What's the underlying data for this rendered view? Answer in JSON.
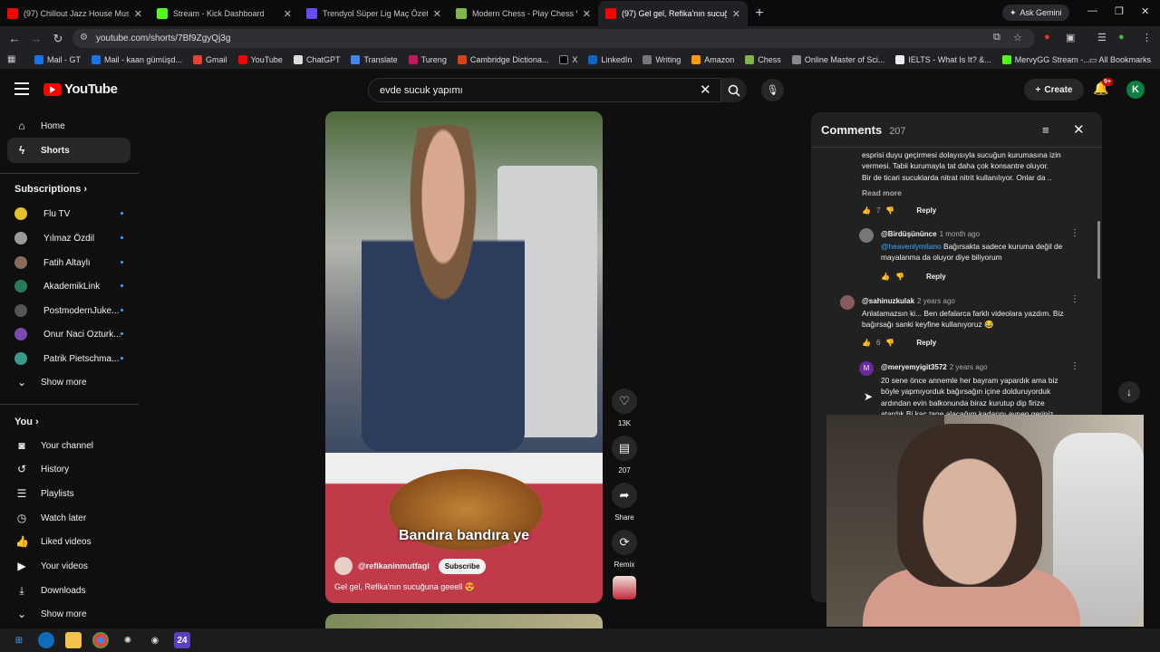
{
  "browser": {
    "tabs": [
      {
        "title": "(97) Chillout Jazz House Music",
        "color": "#ff0000",
        "active": false
      },
      {
        "title": "Stream - Kick Dashboard",
        "color": "#53fc18",
        "active": false
      },
      {
        "title": "Trendyol Süper Lig Maç Özetle",
        "color": "#6a4cff",
        "active": false
      },
      {
        "title": "Modern Chess - Play Chess Var",
        "color": "#81b64c",
        "active": false
      },
      {
        "title": "(97) Gel gel, Refika'nın sucuğu",
        "color": "#ff0000",
        "active": true
      }
    ],
    "gemini_label": "Ask Gemini",
    "url": "youtube.com/shorts/7Bf9ZgyQj3g",
    "bookmarks": [
      "Mail - GT",
      "Mail - kaan gümüşd...",
      "Gmail",
      "YouTube",
      "ChatGPT",
      "Translate",
      "Tureng",
      "Cambridge Dictiona...",
      "X",
      "LinkedIn",
      "Writing",
      "Amazon",
      "Chess",
      "Online Master of Sci...",
      "IELTS - What Is It? &...",
      "MervyGG Stream -..."
    ],
    "all_bookmarks": "All Bookmarks"
  },
  "header": {
    "logo": "YouTube",
    "search_value": "evde sucuk yapımı",
    "create_label": "Create",
    "notif_badge": "9+",
    "avatar_letter": "K"
  },
  "sidebar": {
    "home": "Home",
    "shorts": "Shorts",
    "subscriptions_title": "Subscriptions",
    "channels": [
      {
        "name": "Flu TV",
        "color": "#e5c02a"
      },
      {
        "name": "Yılmaz Özdil",
        "color": "#9a9a9a"
      },
      {
        "name": "Fatih Altaylı",
        "color": "#8a6a5a"
      },
      {
        "name": "AkademikLink",
        "color": "#2a7a5a"
      },
      {
        "name": "PostmodernJuke...",
        "color": "#555"
      },
      {
        "name": "Onur Naci Ozturk...",
        "color": "#7a4ab0"
      },
      {
        "name": "Patrik Pietschma...",
        "color": "#3a9a8a"
      }
    ],
    "show_more": "Show more",
    "you_title": "You",
    "you_items": [
      "Your channel",
      "History",
      "Playlists",
      "Watch later",
      "Liked videos",
      "Your videos",
      "Downloads"
    ],
    "show_more_2": "Show more"
  },
  "video": {
    "caption": "Bandıra bandıra ye",
    "channel": "@refikaninmutfagi",
    "subscribe": "Subscribe",
    "title": "Gel gel, Refika'nın sucuğuna geeell 😍"
  },
  "actions": {
    "likes": "13K",
    "comments": "207",
    "share": "Share",
    "remix": "Remix"
  },
  "comments": {
    "title": "Comments",
    "count": "207",
    "top_text": [
      "esprisi duyu geçirmesi dolayısıyla sucuğun kurumasına izin",
      "vermesi. Tabii kurumayla tat daha çok konsantre oluyor.",
      "Bir de ticari sucuklarda nitrat nitrit kullanılıyor. Onlar da .."
    ],
    "read_more": "Read more",
    "top_likes": "7",
    "reply": "Reply",
    "items": [
      {
        "author": "@Birdüşününce",
        "ago": "1 month ago",
        "mention": "@heavenlymilano",
        "lines": [
          "Bağırsakta sadece kuruma değil de",
          "mayalanma da oluyor diye biliyorum"
        ],
        "likes": ""
      },
      {
        "author": "@sahinuzkulak",
        "ago": "2 years ago",
        "lines": [
          "Anlatamazsın ki... Ben defalarca farklı videolara yazdım. Biz",
          "bağırsağı sanki keyfine kullanıyoruz 😂"
        ],
        "likes": "6"
      },
      {
        "author": "@meryemyigit3572",
        "ago": "2 years ago",
        "lines": [
          "20 sene önce annemle her bayram yapardık ama biz",
          "böyle yapmıyorduk bağırsağın içine dolduruyorduk",
          "ardından evin balkonunda biraz kurutup dip firize",
          "atardık Bi kaç tane alacağım kadarını aynen geriniz"
        ],
        "likes": ""
      }
    ]
  },
  "taskbar": [
    "windows",
    "edge",
    "explorer",
    "chrome",
    "chatgpt",
    "obs",
    "24"
  ]
}
